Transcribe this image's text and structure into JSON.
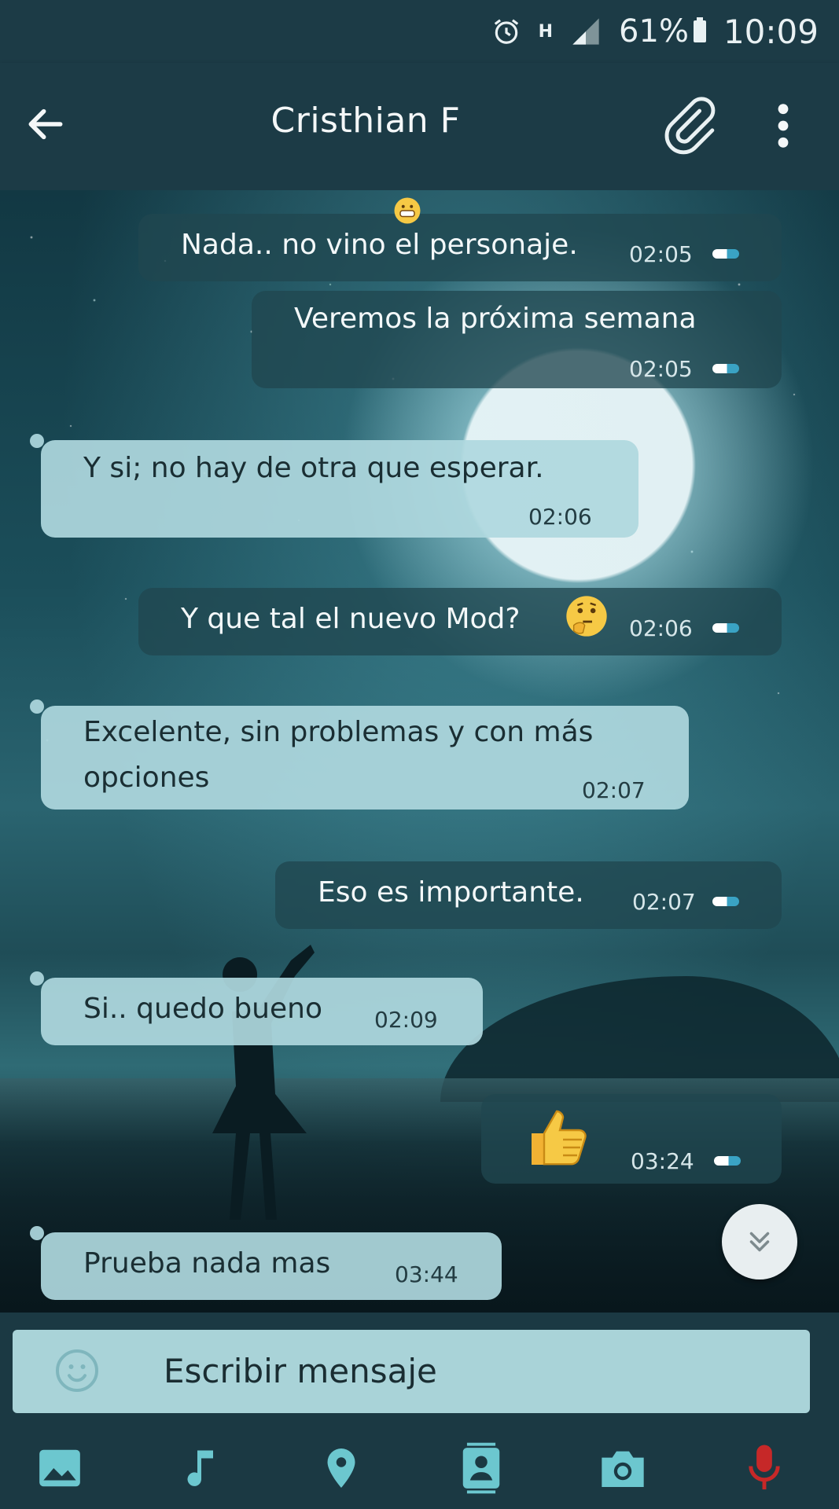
{
  "status_bar": {
    "battery_percent": "61%",
    "time": "10:09",
    "network": "H",
    "icons": [
      "alarm-icon",
      "network-h-icon",
      "signal-icon",
      "battery-icon"
    ]
  },
  "header": {
    "title": "Cristhian F",
    "icons": [
      "back-arrow-icon",
      "paperclip-icon",
      "overflow-menu-icon"
    ]
  },
  "messages": [
    {
      "direction": "out",
      "text": "Nada.. no vino el personaje.",
      "time": "02:05",
      "emoji_above": "grinning-emoji"
    },
    {
      "direction": "out",
      "text": "Veremos la próxima semana",
      "time": "02:05"
    },
    {
      "direction": "in",
      "text": "Y si; no hay de otra que esperar.",
      "time": "02:06"
    },
    {
      "direction": "out",
      "text": "Y que tal el nuevo Mod?",
      "time": "02:06",
      "emoji": "thinking-face-emoji"
    },
    {
      "direction": "in",
      "text_line1": "Excelente, sin problemas y con más",
      "text_line2": "opciones",
      "time": "02:07"
    },
    {
      "direction": "out",
      "text": "Eso es importante.",
      "time": "02:07"
    },
    {
      "direction": "in",
      "text": "Si.. quedo bueno",
      "time": "02:09"
    },
    {
      "direction": "out",
      "text": "",
      "emoji": "thumbs-up-emoji",
      "time": "03:24"
    },
    {
      "direction": "in",
      "text": "Prueba nada mas",
      "time": "03:44"
    }
  ],
  "composer": {
    "placeholder": "Escribir mensaje"
  },
  "colors": {
    "header": "#1c3b46",
    "incoming_bubble": "#afd8de",
    "outgoing_bubble": "#204650",
    "composer": "#a9d3d8",
    "icon_accent": "#6cc7cf",
    "mic_red": "#c62828"
  },
  "tools": [
    "gallery-icon",
    "music-icon",
    "location-icon",
    "contact-icon",
    "camera-icon",
    "microphone-icon"
  ]
}
